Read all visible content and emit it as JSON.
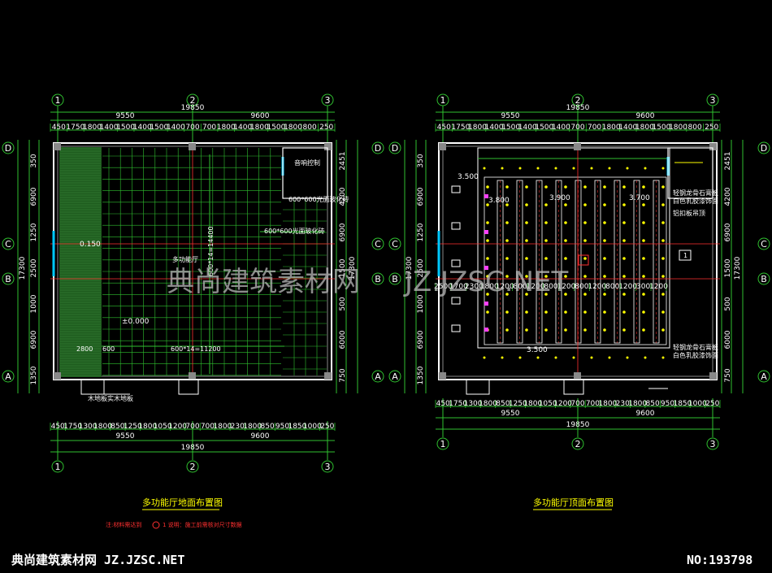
{
  "colors": {
    "background": "#000000",
    "line": "#2fc02f",
    "wall": "#ffffff",
    "column": "#808080",
    "axis": "#ff3030",
    "glass": "#00c8ff",
    "text": "#ffffff",
    "title": "#ffff00"
  },
  "plan_left": {
    "title": "多功能厅地面布置图",
    "axes_top": [
      "1",
      "2",
      "3"
    ],
    "axes_side": [
      "D",
      "C",
      "B",
      "A"
    ],
    "dim_total": "19850",
    "dim_half_left": "9550",
    "dim_half_right": "9600",
    "dim_detail_top": [
      "450",
      "1750",
      "1800",
      "1400",
      "1500",
      "1400",
      "1500",
      "1400",
      "700",
      "700",
      "1800",
      "1400",
      "1800",
      "1500",
      "1800",
      "800",
      "250"
    ],
    "dim_detail_bottom": [
      "450",
      "1750",
      "1300",
      "1800",
      "850",
      "1250",
      "1800",
      "1050",
      "1200",
      "700",
      "700",
      "1800",
      "230",
      "1800",
      "850",
      "950",
      "1850",
      "1000",
      "250"
    ],
    "dim_left": [
      "1350",
      "6900",
      "1000",
      "2500",
      "1250",
      "6900",
      "350"
    ],
    "dim_right": [
      "2451",
      "4200",
      "6900",
      "1500",
      "500",
      "6000",
      "750"
    ],
    "dim_left_outer": "17300",
    "dim_right_outer": "17300",
    "notes": {
      "room": "多功能厅",
      "stage_dim": "2800",
      "bottom_mid": "600*14=11200",
      "bottom_side": "600",
      "vert_dim": "600*14=14400",
      "level_a": "0.150",
      "level_b": "±0.000",
      "corner_label": "音响控制",
      "box_label": "600*600光面玻化砖",
      "grid_label": "600*600光面玻化砖",
      "bottom_label": "木地板实木地板"
    }
  },
  "plan_right": {
    "title": "多功能厅顶面布置图",
    "axes_top": [
      "1",
      "2",
      "3"
    ],
    "axes_side": [
      "D",
      "C",
      "B",
      "A"
    ],
    "dim_total": "19850",
    "dim_half_left": "9550",
    "dim_half_right": "9600",
    "dim_detail_top": [
      "450",
      "1750",
      "1800",
      "1400",
      "1500",
      "1400",
      "1500",
      "1400",
      "700",
      "700",
      "1800",
      "1400",
      "1800",
      "1500",
      "1800",
      "800",
      "250"
    ],
    "dim_detail_bottom": [
      "450",
      "1750",
      "1300",
      "1800",
      "850",
      "1250",
      "1800",
      "1050",
      "1200",
      "700",
      "700",
      "1800",
      "230",
      "1800",
      "850",
      "950",
      "1850",
      "1000",
      "250"
    ],
    "dim_row_mid": [
      "2500",
      "1700",
      "2300",
      "1800",
      "1200",
      "800",
      "1200",
      "800",
      "1200",
      "800",
      "1200",
      "800",
      "1200",
      "300",
      "1200"
    ],
    "levels": [
      "3.500",
      "3.800",
      "3.900",
      "3.700",
      "3.500"
    ],
    "dim_left": [
      "1350",
      "6900",
      "1000",
      "2500",
      "1250",
      "6900",
      "350"
    ],
    "dim_right": [
      "2451",
      "4200",
      "6900",
      "1500",
      "500",
      "6000",
      "750"
    ],
    "dim_left_outer": "17300",
    "dim_right_outer": "17300",
    "notes": {
      "n1": "轻钢龙骨石膏板",
      "n2": "白色乳胶漆饰面",
      "n3": "轻钢龙骨石膏板",
      "n4": "白色乳胶漆饰面",
      "n5": "铝扣板吊顶",
      "mark": "1"
    }
  },
  "watermark": {
    "text": "典尚建筑素材网",
    "url": "JZ.JZSC.NET"
  },
  "footer": {
    "brand": "典尚建筑素材网 JZ.JZSC.NET",
    "id": "NO:193798"
  },
  "red_notes": {
    "left": "注:材料需达到",
    "mid": "1 说明：施工前需核对尺寸数据"
  }
}
